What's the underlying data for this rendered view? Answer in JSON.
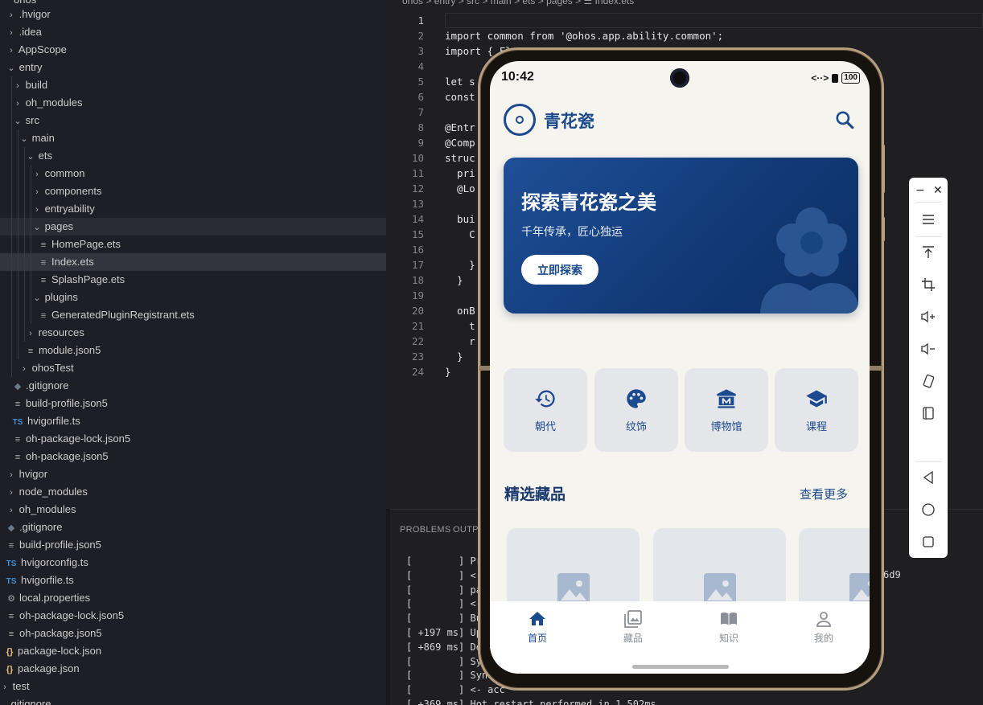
{
  "explorer": {
    "root": "ohos",
    "items": [
      ".hvigor",
      ".idea",
      "AppScope",
      "entry",
      "build",
      "oh_modules",
      "src",
      "main",
      "ets",
      "common",
      "components",
      "entryability",
      "pages",
      "HomePage.ets",
      "Index.ets",
      "SplashPage.ets",
      "plugins",
      "GeneratedPluginRegistrant.ets",
      "resources",
      "module.json5",
      "ohosTest",
      ".gitignore",
      "build-profile.json5",
      "hvigorfile.ts",
      "oh-package-lock.json5",
      "oh-package.json5",
      "hvigor",
      "node_modules",
      "oh_modules",
      ".gitignore",
      "build-profile.json5",
      "hvigorconfig.ts",
      "hvigorfile.ts",
      "local.properties",
      "oh-package-lock.json5",
      "oh-package.json5",
      "package-lock.json",
      "package.json",
      "test",
      ".gitignore"
    ]
  },
  "editor": {
    "breadcrumb": "ohos > entry > src > main > ets > pages > ☰ Index.ets",
    "lines": [
      {
        "n": "1",
        "t": ""
      },
      {
        "n": "2",
        "t": "import common from '@ohos.app.ability.common';"
      },
      {
        "n": "3",
        "t": "import { Fl"
      },
      {
        "n": "4",
        "t": ""
      },
      {
        "n": "5",
        "t": "let s"
      },
      {
        "n": "6",
        "t": "const"
      },
      {
        "n": "7",
        "t": ""
      },
      {
        "n": "8",
        "t": "@Entr"
      },
      {
        "n": "9",
        "t": "@Comp"
      },
      {
        "n": "10",
        "t": "struc"
      },
      {
        "n": "11",
        "t": "  pri"
      },
      {
        "n": "12",
        "t": "  @Lo"
      },
      {
        "n": "13",
        "t": ""
      },
      {
        "n": "14",
        "t": "  bui"
      },
      {
        "n": "15",
        "t": "    C"
      },
      {
        "n": "16",
        "t": ""
      },
      {
        "n": "17",
        "t": "    }"
      },
      {
        "n": "18",
        "t": "  }"
      },
      {
        "n": "19",
        "t": ""
      },
      {
        "n": "20",
        "t": "  onB"
      },
      {
        "n": "21",
        "t": "    t"
      },
      {
        "n": "22",
        "t": "    r"
      },
      {
        "n": "23",
        "t": "  }"
      },
      {
        "n": "24",
        "t": "}"
      }
    ]
  },
  "panel": {
    "tabs": [
      "PROBLEMS",
      "OUTP"
    ],
    "log": [
      "[        ] Pr",
      "[        ] <-",
      "[        ] pa",
      "[        ] <-",
      "[        ] Bu",
      "[ +197 ms] Up",
      "[ +869 ms] De",
      "[        ] Sy",
      "[        ] Syn",
      "[        ] <- acc",
      "[ +369 ms] Hot restart performed in 1,502ms."
    ],
    "log_tail": "6d9"
  },
  "phone": {
    "status": {
      "time": "10:42",
      "icons": "<··>",
      "battery": "100"
    },
    "app": {
      "title": "青花瓷"
    },
    "banner": {
      "title": "探索青花瓷之美",
      "subtitle": "千年传承，匠心独运",
      "button": "立即探索"
    },
    "categories": [
      {
        "label": "朝代",
        "icon": "history-icon"
      },
      {
        "label": "纹饰",
        "icon": "palette-icon"
      },
      {
        "label": "博物馆",
        "icon": "museum-icon"
      },
      {
        "label": "课程",
        "icon": "graduation-cap-icon"
      }
    ],
    "section": {
      "title": "精选藏品",
      "more": "查看更多"
    },
    "tabs": [
      {
        "label": "首页",
        "icon": "home-icon",
        "active": true
      },
      {
        "label": "藏品",
        "icon": "collection-icon",
        "active": false
      },
      {
        "label": "知识",
        "icon": "book-icon",
        "active": false
      },
      {
        "label": "我的",
        "icon": "person-icon",
        "active": false
      }
    ]
  },
  "emulator_toolbar": {
    "top": [
      "−",
      "✕"
    ],
    "buttons": [
      "menu-icon",
      "pin-top-icon",
      "crop-icon",
      "volume-up-icon",
      "volume-down-icon",
      "rotate-icon",
      "fold-icon",
      "back-icon",
      "home-icon",
      "recents-icon"
    ]
  },
  "colors": {
    "accent": "#1b4a8e",
    "banner": "#1f4f98",
    "editor_bg": "#1f1f22",
    "sidebar_bg": "#1e1e26"
  }
}
